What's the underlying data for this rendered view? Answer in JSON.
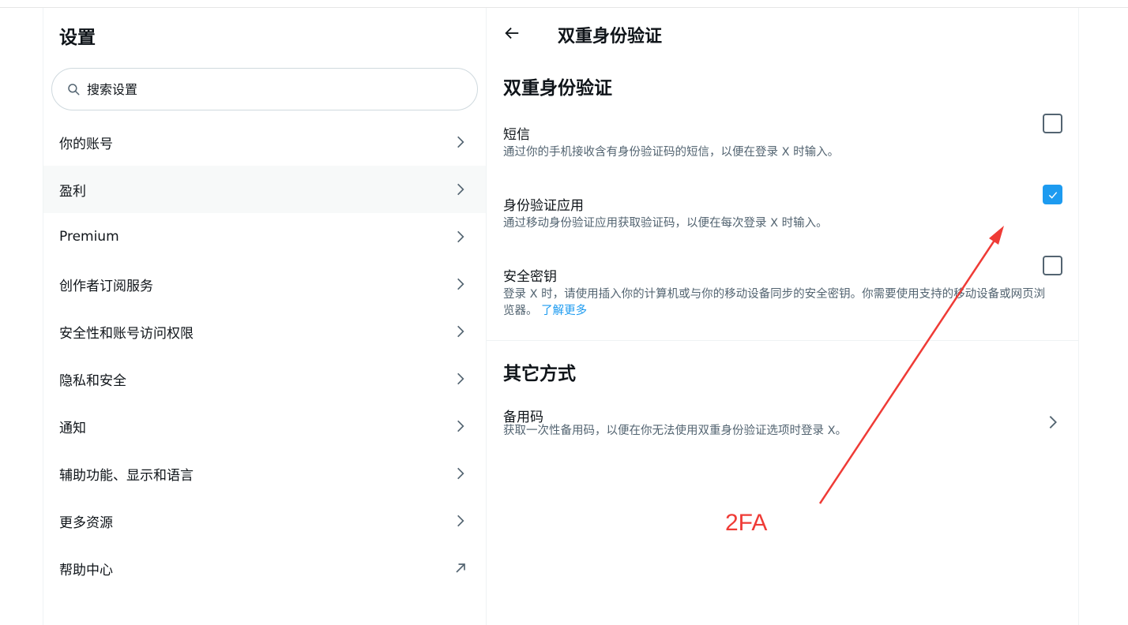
{
  "settings": {
    "title": "设置",
    "search_placeholder": "搜索设置",
    "items": [
      {
        "label": "你的账号",
        "icon": "chevron-right-icon"
      },
      {
        "label": "盈利",
        "icon": "chevron-right-icon"
      },
      {
        "label": "Premium",
        "icon": "chevron-right-icon"
      },
      {
        "label": "创作者订阅服务",
        "icon": "chevron-right-icon"
      },
      {
        "label": "安全性和账号访问权限",
        "icon": "chevron-right-icon"
      },
      {
        "label": "隐私和安全",
        "icon": "chevron-right-icon"
      },
      {
        "label": "通知",
        "icon": "chevron-right-icon"
      },
      {
        "label": "辅助功能、显示和语言",
        "icon": "chevron-right-icon"
      },
      {
        "label": "更多资源",
        "icon": "chevron-right-icon"
      },
      {
        "label": "帮助中心",
        "icon": "external-link-icon"
      }
    ]
  },
  "detail": {
    "title": "双重身份验证",
    "section_2fa": "双重身份验证",
    "options": [
      {
        "label": "短信",
        "desc": "通过你的手机接收含有身份验证码的短信，以便在登录 X 时输入。",
        "checked": false
      },
      {
        "label": "身份验证应用",
        "desc": "通过移动身份验证应用获取验证码，以便在每次登录 X 时输入。",
        "checked": true
      },
      {
        "label": "安全密钥",
        "desc": "登录 X 时，请使用插入你的计算机或与你的移动设备同步的安全密钥。你需要使用支持的移动设备或网页浏览器。",
        "link": "了解更多",
        "checked": false
      }
    ],
    "section_other": "其它方式",
    "backup": {
      "label": "备用码",
      "desc": "获取一次性备用码，以便在你无法使用双重身份验证选项时登录 X。"
    }
  },
  "annotation": {
    "text": "2FA",
    "color": "#ef3b36"
  },
  "colors": {
    "accent": "#1d9bf0",
    "secondary_text": "#536471",
    "active_row": "#f7f9f9"
  }
}
